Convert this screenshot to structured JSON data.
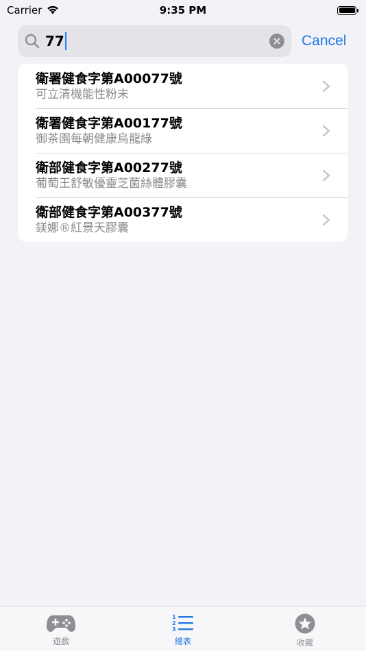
{
  "status_bar": {
    "carrier": "Carrier",
    "time": "9:35 PM"
  },
  "search": {
    "query": "77",
    "cancel_label": "Cancel"
  },
  "results": [
    {
      "title": "衛署健食字第A00077號",
      "subtitle": "可立清機能性粉末"
    },
    {
      "title": "衛署健食字第A00177號",
      "subtitle": "御茶園每朝健康烏龍綠"
    },
    {
      "title": "衛部健食字第A00277號",
      "subtitle": "葡萄王舒敏優靈芝菌絲體膠囊"
    },
    {
      "title": "衛部健食字第A00377號",
      "subtitle": "鎂娜®紅景天膠囊"
    }
  ],
  "tab_bar": {
    "tabs": [
      {
        "label": "遊戲",
        "icon": "gamecontroller-icon",
        "active": false
      },
      {
        "label": "總表",
        "icon": "numbered-list-icon",
        "active": true
      },
      {
        "label": "收藏",
        "icon": "star-circle-icon",
        "active": false
      }
    ]
  },
  "colors": {
    "accent": "#1f78e6",
    "background": "#f2f2f7",
    "inactive_tab": "#8e8e93"
  }
}
